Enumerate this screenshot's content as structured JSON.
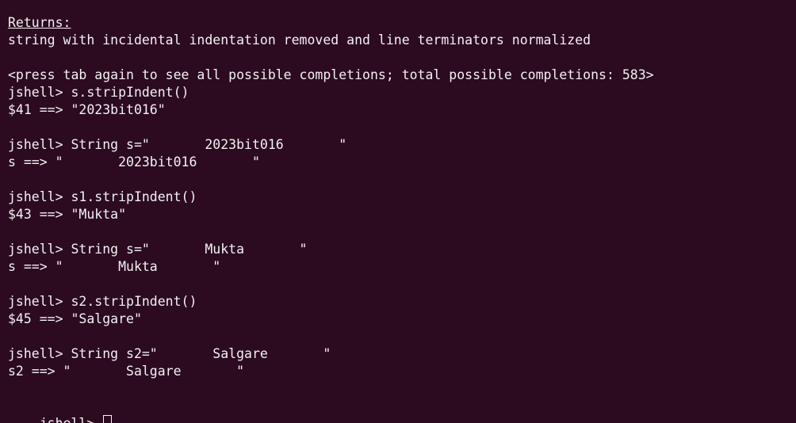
{
  "terminal": {
    "colors": {
      "background": "#2c0a20",
      "foreground": "#f2f2f2"
    },
    "lines": [
      {
        "text": "Returns:",
        "style": "underline"
      },
      {
        "text": "string with incidental indentation removed and line terminators normalized"
      },
      {
        "text": ""
      },
      {
        "text": "<press tab again to see all possible completions; total possible completions: 583>"
      },
      {
        "text": "jshell> s.stripIndent()"
      },
      {
        "text": "$41 ==> \"2023bit016\""
      },
      {
        "text": ""
      },
      {
        "text": "jshell> String s=\"       2023bit016       \""
      },
      {
        "text": "s ==> \"       2023bit016       \""
      },
      {
        "text": ""
      },
      {
        "text": "jshell> s1.stripIndent()"
      },
      {
        "text": "$43 ==> \"Mukta\""
      },
      {
        "text": ""
      },
      {
        "text": "jshell> String s=\"       Mukta       \""
      },
      {
        "text": "s ==> \"       Mukta       \""
      },
      {
        "text": ""
      },
      {
        "text": "jshell> s2.stripIndent()"
      },
      {
        "text": "$45 ==> \"Salgare\""
      },
      {
        "text": ""
      },
      {
        "text": "jshell> String s2=\"       Salgare       \""
      },
      {
        "text": "s2 ==> \"       Salgare       \""
      },
      {
        "text": ""
      }
    ],
    "prompt": "jshell> ",
    "input_value": ""
  }
}
